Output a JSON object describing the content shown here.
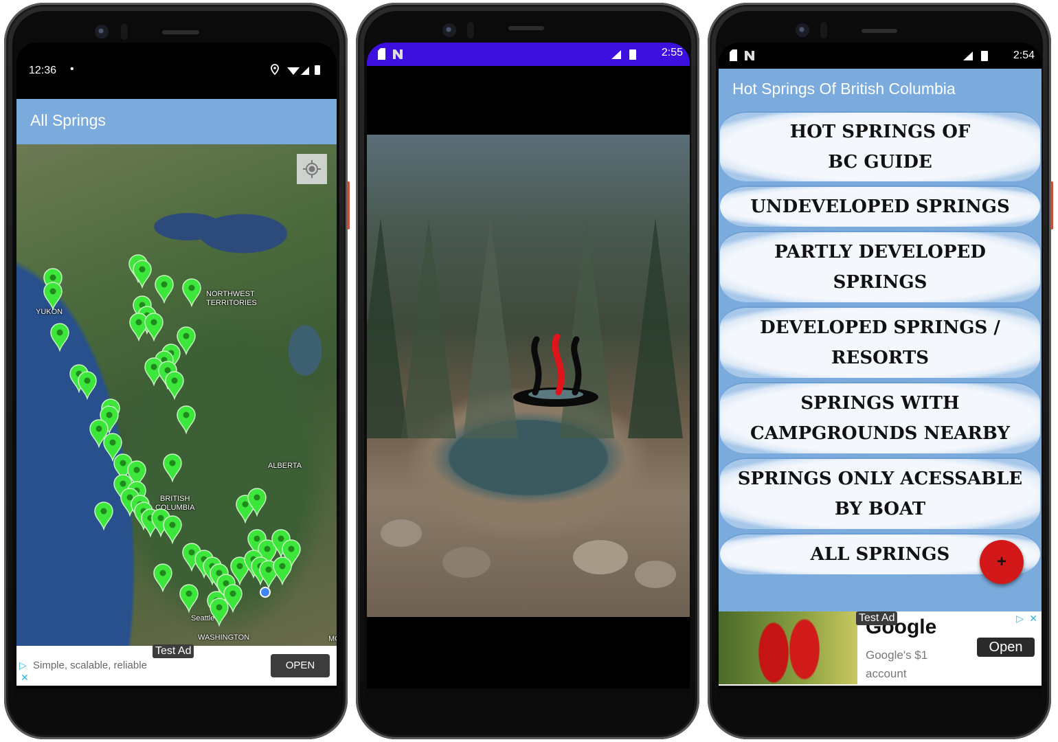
{
  "phones": {
    "map_screen": {
      "status": {
        "time": "12:36",
        "notification_dot": "•"
      },
      "appbar": {
        "title": "All Springs"
      },
      "map": {
        "labels": {
          "nwt": "NORTHWEST\nTERRITORIES",
          "yukon": "YUKON",
          "alberta": "ALBERTA",
          "bc": "BRITISH\nCOLUMBIA",
          "seattle": "Seattle",
          "washington": "WASHINGTON",
          "mt": "MO"
        },
        "marker_color": "#3de63a",
        "my_location_label": "my location"
      },
      "ad": {
        "tag": "Test Ad",
        "text": "Simple, scalable, reliable",
        "open_label": "OPEN",
        "adchoices": "▷",
        "close": "✕"
      }
    },
    "splash_screen": {
      "status": {
        "time": "2:55",
        "network": "LTE"
      },
      "statusbar_color": "#3d10e0",
      "logo": "hot-spring-steam-logo"
    },
    "menu_screen": {
      "status": {
        "time": "2:54",
        "network": "LTE"
      },
      "appbar": {
        "title": "Hot Springs Of British Columbia"
      },
      "menu_items": [
        {
          "label": "HOT SPRINGS OF\nBC GUIDE"
        },
        {
          "label": "UNDEVELOPED SPRINGS"
        },
        {
          "label": "PARTLY DEVELOPED\nSPRINGS"
        },
        {
          "label": "DEVELOPED SPRINGS /\nRESORTS"
        },
        {
          "label": "SPRINGS WITH\nCAMPGROUNDS NEARBY"
        },
        {
          "label": "SPRINGS ONLY ACESSABLE\nBY BOAT"
        },
        {
          "label": "ALL SPRINGS"
        }
      ],
      "fab": {
        "icon": "+",
        "color": "#d21818"
      },
      "ad": {
        "tag": "Test Ad",
        "brand": "Google",
        "desc": "Google's $1 account",
        "open_label": "Open",
        "adchoices": "▷",
        "close": "✕"
      }
    }
  },
  "theme": {
    "appbar_color": "#7aabdc"
  }
}
